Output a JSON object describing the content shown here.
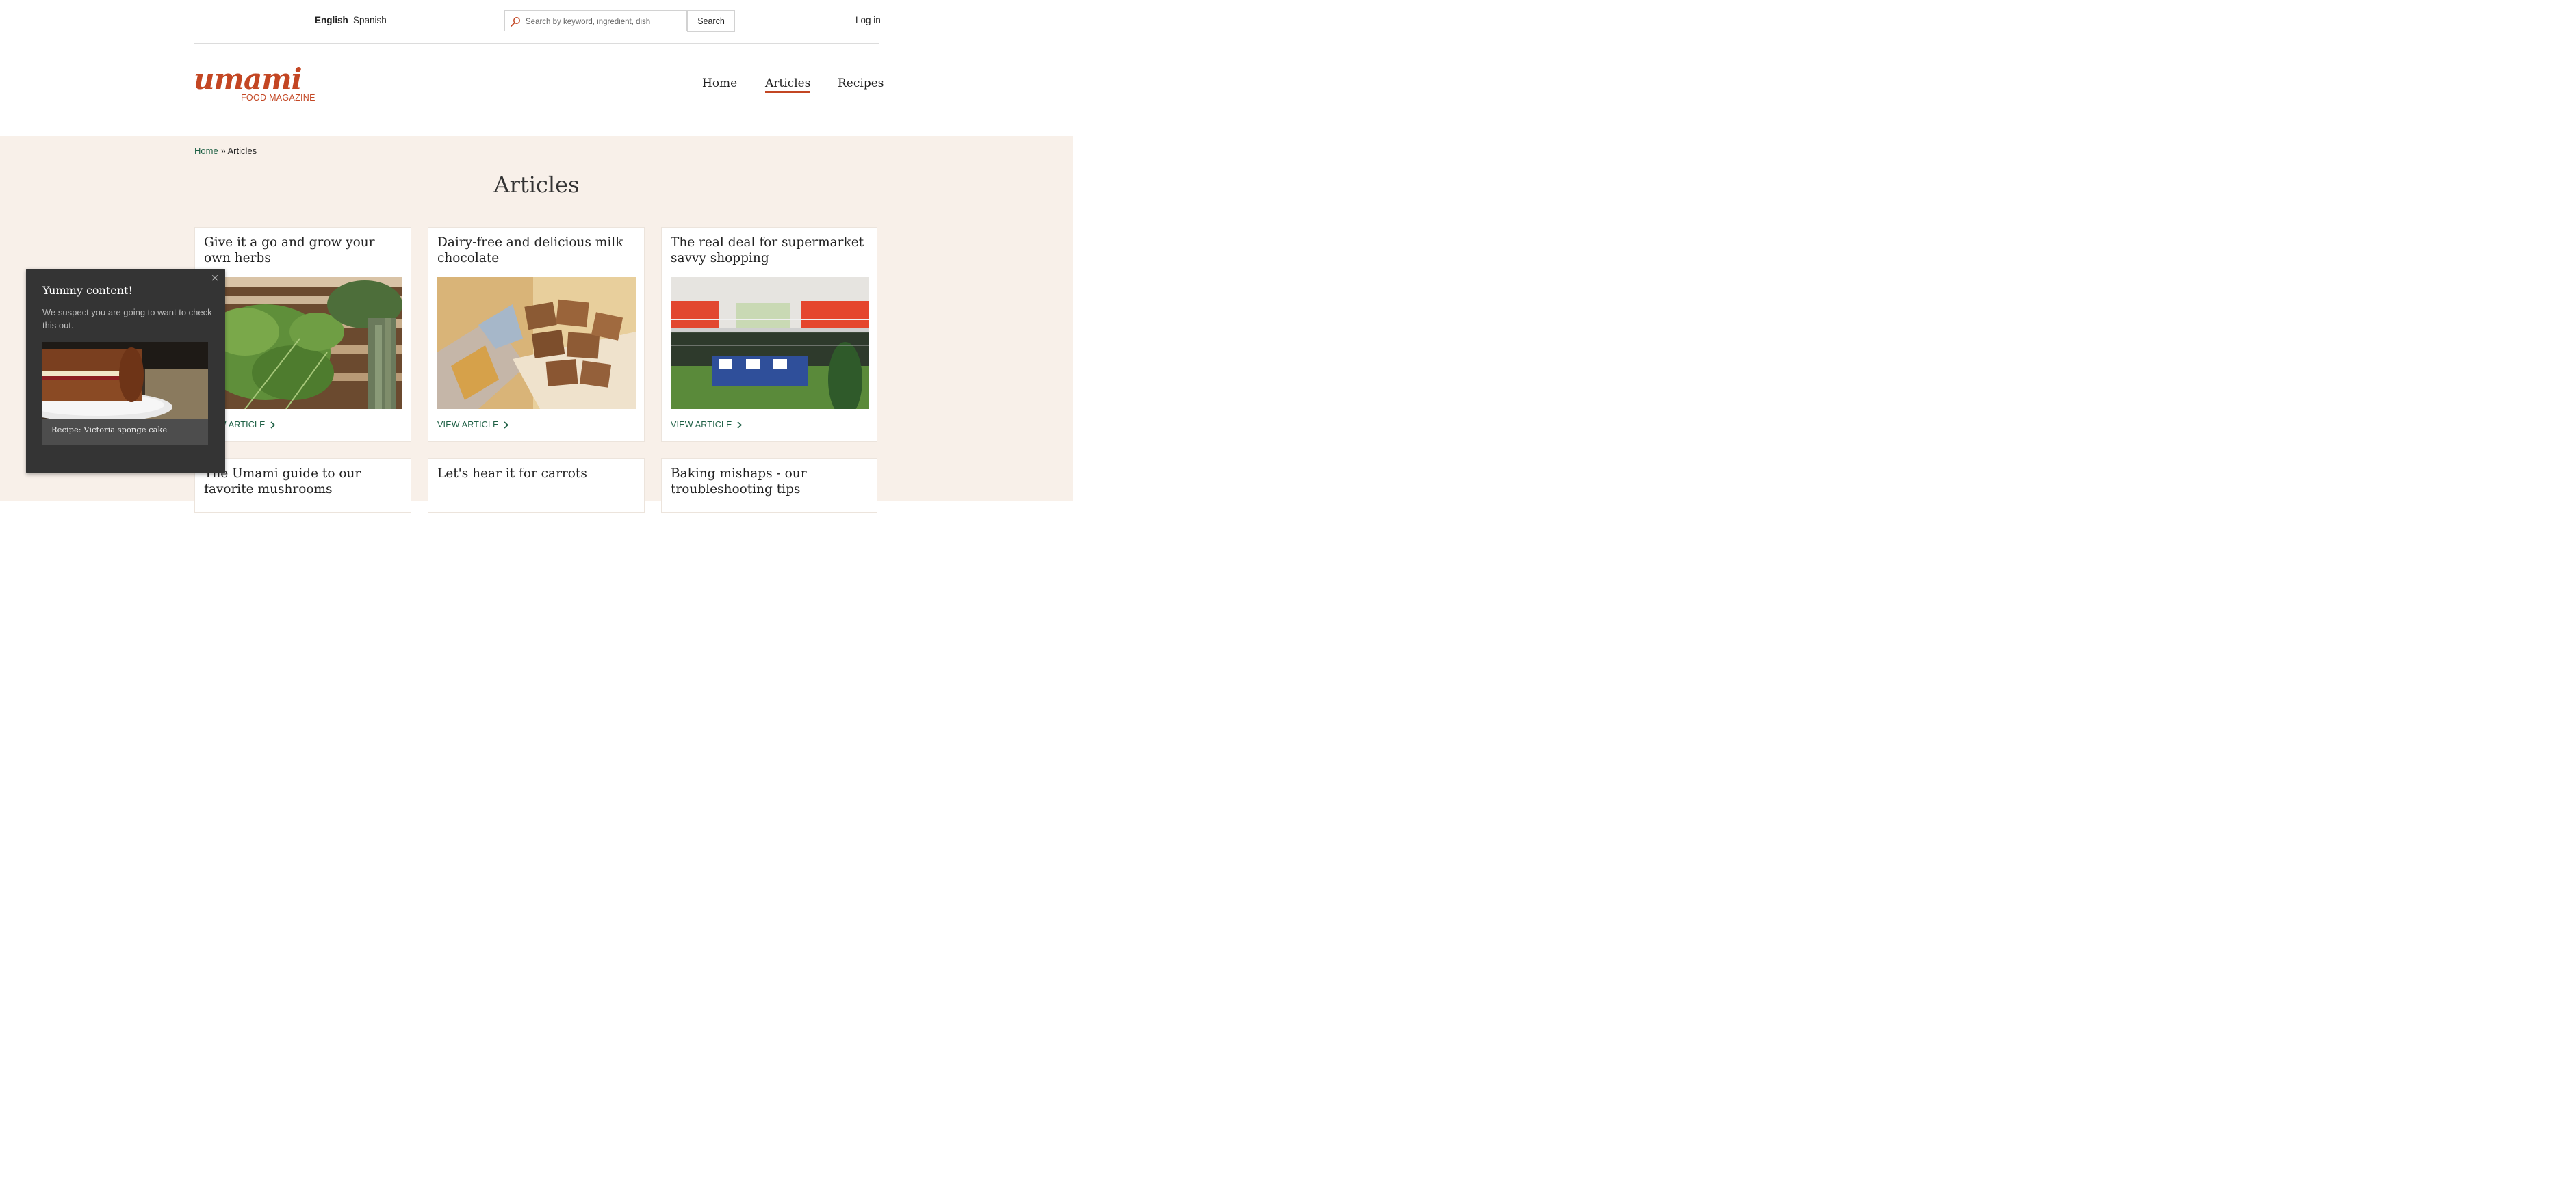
{
  "languages": [
    {
      "label": "English",
      "active": true
    },
    {
      "label": "Spanish",
      "active": false
    }
  ],
  "search": {
    "placeholder": "Search by keyword, ingredient, dish",
    "button": "Search"
  },
  "account": {
    "login": "Log in"
  },
  "brand": {
    "logo_text": "umami",
    "subtitle": "FOOD MAGAZINE",
    "color": "#c34623"
  },
  "nav": [
    {
      "label": "Home",
      "active": false
    },
    {
      "label": "Articles",
      "active": true
    },
    {
      "label": "Recipes",
      "active": false
    }
  ],
  "breadcrumb": {
    "home": "Home",
    "separator": "»",
    "current": "Articles"
  },
  "page": {
    "title": "Articles"
  },
  "articles": [
    {
      "title": "Give it a go and grow your own herbs",
      "link": "VIEW ARTICLE",
      "image": "herbs-photo"
    },
    {
      "title": "Dairy-free and delicious milk chocolate",
      "link": "VIEW ARTICLE",
      "image": "chocolate-photo"
    },
    {
      "title": "The real deal for supermarket savvy shopping",
      "link": "VIEW ARTICLE",
      "image": "supermarket-photo"
    },
    {
      "title": "The Umami guide to our favorite mushrooms"
    },
    {
      "title": "Let's hear it for carrots"
    },
    {
      "title": "Baking mishaps - our troubleshooting tips"
    }
  ],
  "popup": {
    "close": "×",
    "title": "Yummy content!",
    "text": "We suspect you are going to want to check this out.",
    "caption": "Recipe: Victoria sponge cake",
    "image": "sponge-cake-photo"
  },
  "colors": {
    "accent": "#c34623",
    "link": "#1e6045",
    "background": "#f8f0e9"
  }
}
